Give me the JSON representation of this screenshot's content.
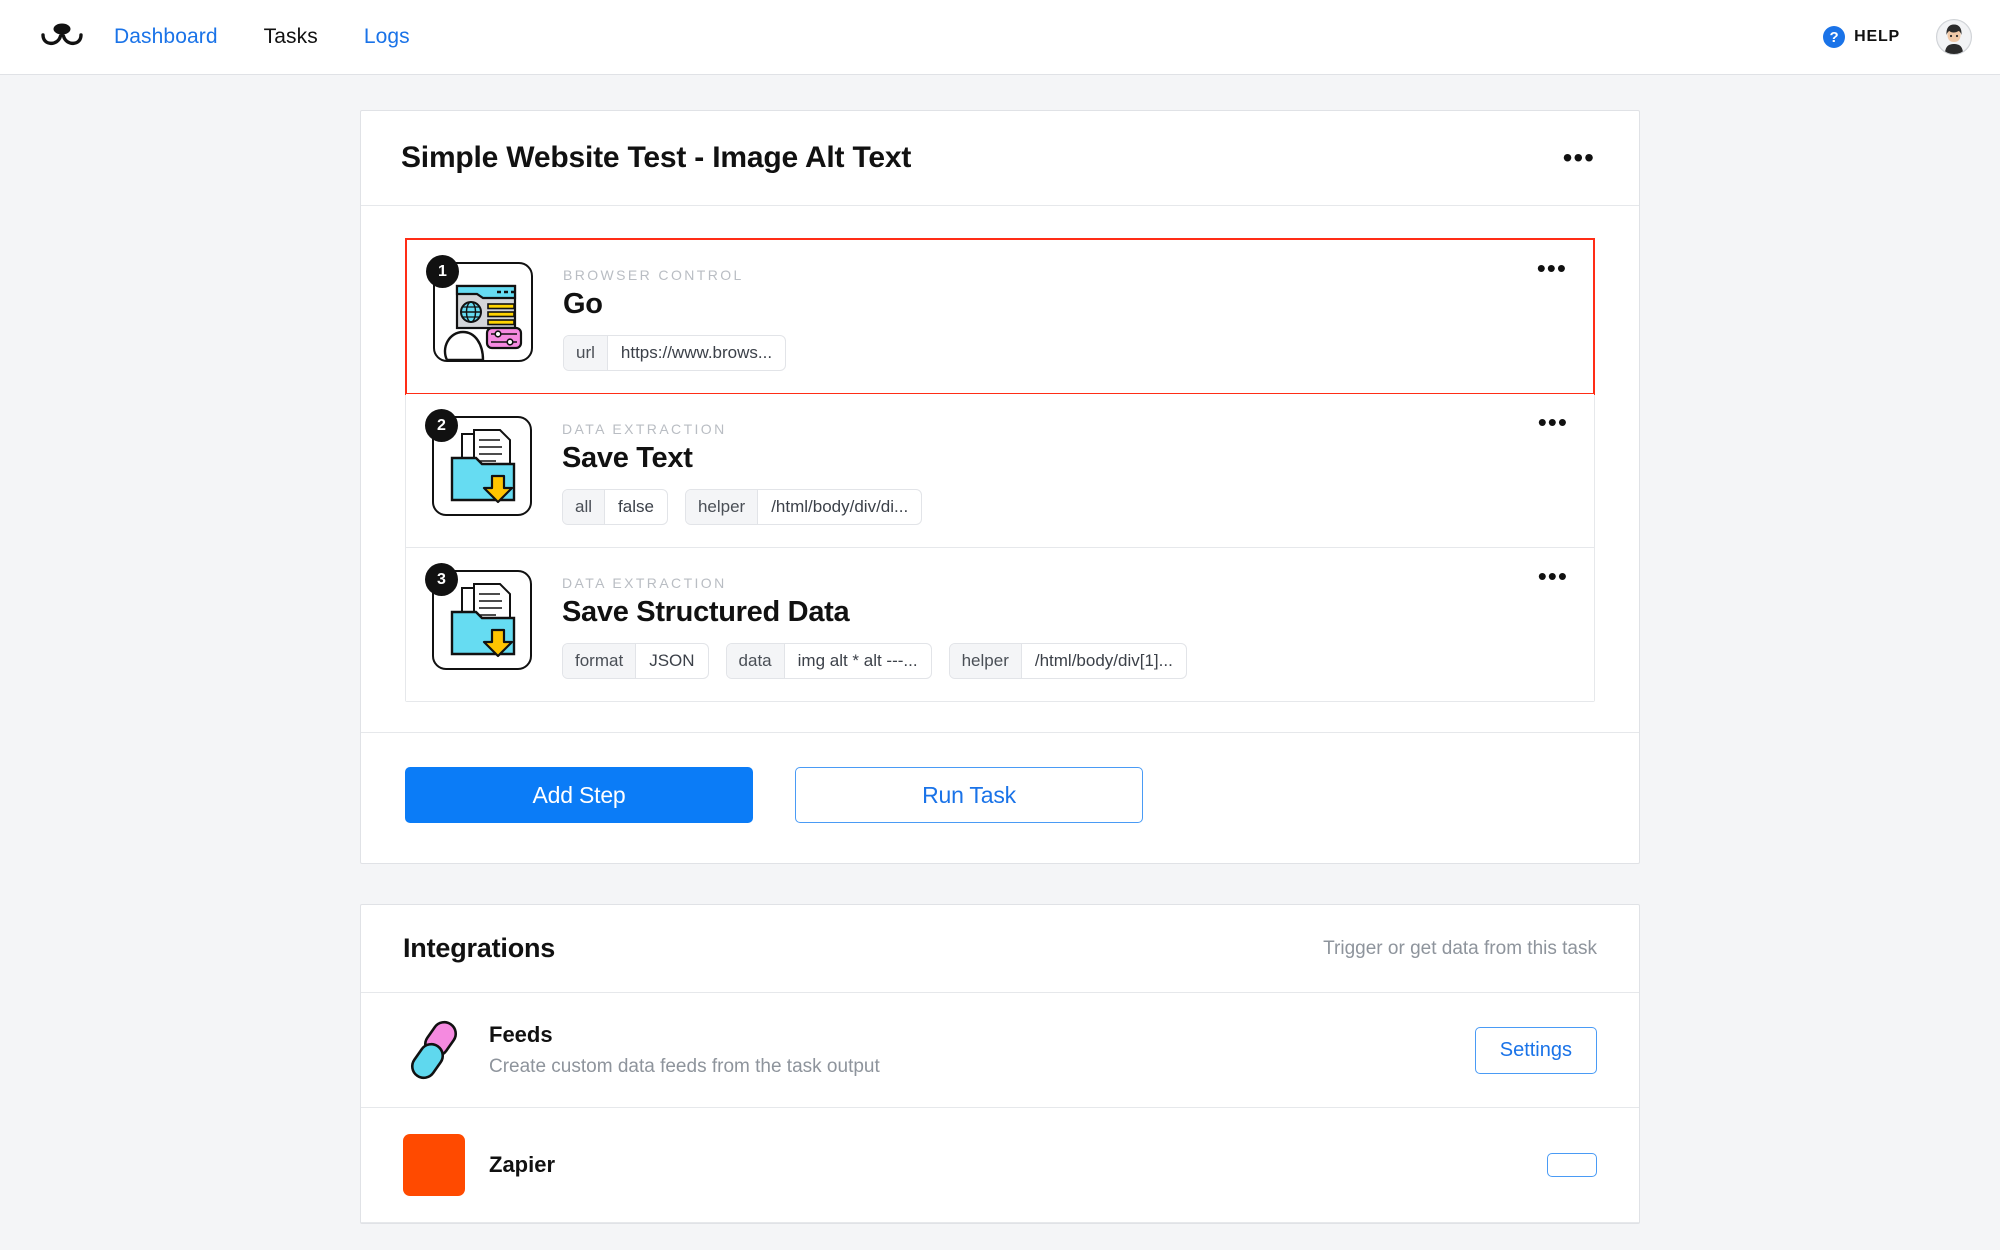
{
  "header": {
    "logo_name": "browse-ai-logo",
    "nav": [
      {
        "label": "Dashboard",
        "active": false
      },
      {
        "label": "Tasks",
        "active": true
      },
      {
        "label": "Logs",
        "active": false
      }
    ],
    "help_label": "HELP",
    "help_glyph": "?",
    "avatar_name": "user-avatar"
  },
  "task": {
    "title": "Simple Website Test - Image Alt Text",
    "menu_glyph": "•••",
    "steps": [
      {
        "number": "1",
        "kicker": "BROWSER CONTROL",
        "name": "Go",
        "icon": "browser-control-icon",
        "selected": true,
        "params": [
          {
            "key": "url",
            "value": "https://www.brows..."
          }
        ]
      },
      {
        "number": "2",
        "kicker": "DATA EXTRACTION",
        "name": "Save Text",
        "icon": "save-text-icon",
        "selected": false,
        "params": [
          {
            "key": "all",
            "value": "false"
          },
          {
            "key": "helper",
            "value": "/html/body/div/di..."
          }
        ]
      },
      {
        "number": "3",
        "kicker": "DATA EXTRACTION",
        "name": "Save Structured Data",
        "icon": "save-structured-data-icon",
        "selected": false,
        "params": [
          {
            "key": "format",
            "value": "JSON"
          },
          {
            "key": "data",
            "value": "img alt * alt ---..."
          },
          {
            "key": "helper",
            "value": "/html/body/div[1]..."
          }
        ]
      }
    ],
    "add_step_label": "Add Step",
    "run_task_label": "Run Task"
  },
  "integrations": {
    "title": "Integrations",
    "subtitle": "Trigger or get data from this task",
    "rows": [
      {
        "name": "Feeds",
        "description": "Create custom data feeds from the task output",
        "icon": "chain-link-icon",
        "button": "Settings"
      },
      {
        "name": "Zapier",
        "description": "",
        "icon": "zapier-icon",
        "button": ""
      }
    ]
  },
  "colors": {
    "accent_blue": "#0b7cf7",
    "link_blue": "#1a73e8",
    "selected_red": "#ff2d16",
    "page_bg": "#f4f5f7",
    "zapier_orange": "#ff4a00"
  }
}
